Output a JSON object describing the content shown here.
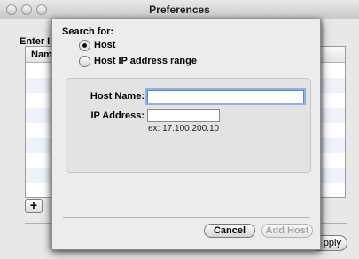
{
  "window": {
    "title": "Preferences",
    "background_label": "Enter I",
    "list_column": "Name",
    "add_label": "+",
    "apply_label": "pply"
  },
  "sheet": {
    "search_for_label": "Search for:",
    "options": [
      {
        "label": "Host",
        "selected": true
      },
      {
        "label": "Host IP address range",
        "selected": false
      }
    ],
    "host_name_label": "Host Name:",
    "host_name_value": "",
    "ip_address_label": "IP Address:",
    "ip_address_value": "",
    "ip_example": "ex: 17.100.200.10",
    "cancel_label": "Cancel",
    "add_host_label": "Add Host",
    "add_host_enabled": false
  },
  "colors": {
    "focus_ring": "#8fb1e6",
    "sheet_background": "#ececec"
  }
}
